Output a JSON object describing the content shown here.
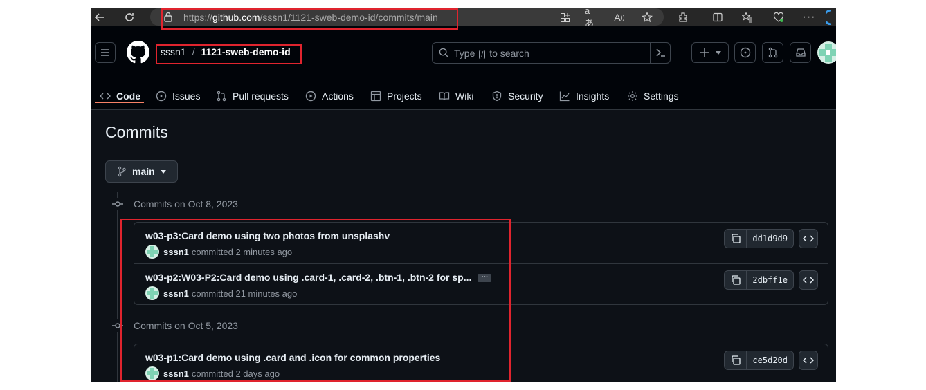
{
  "browser": {
    "url_prefix": "https://",
    "url_host": "github.com",
    "url_path": "/sssn1/1121-sweb-demo-id/commits/main"
  },
  "header": {
    "owner": "sssn1",
    "separator": "/",
    "repo": "1121-sweb-demo-id",
    "search_before": "Type",
    "search_key": "/",
    "search_after": "to search"
  },
  "nav": {
    "tabs": [
      {
        "label": "Code",
        "icon": "code-icon"
      },
      {
        "label": "Issues",
        "icon": "issue-icon"
      },
      {
        "label": "Pull requests",
        "icon": "pull-request-icon"
      },
      {
        "label": "Actions",
        "icon": "play-icon"
      },
      {
        "label": "Projects",
        "icon": "table-icon"
      },
      {
        "label": "Wiki",
        "icon": "book-icon"
      },
      {
        "label": "Security",
        "icon": "shield-icon"
      },
      {
        "label": "Insights",
        "icon": "graph-icon"
      },
      {
        "label": "Settings",
        "icon": "gear-icon"
      }
    ]
  },
  "main": {
    "title": "Commits",
    "branch": "main",
    "groups": [
      {
        "heading": "Commits on Oct 8, 2023",
        "commits": [
          {
            "message": "w03-p3:Card demo using two photos from unsplashv",
            "author": "sssn1",
            "committed": "committed",
            "time": "2 minutes ago",
            "sha": "dd1d9d9",
            "truncated": false
          },
          {
            "message": "w03-p2:W03-P2:Card demo using .card-1, .card-2, .btn-1, .btn-2 for sp...",
            "author": "sssn1",
            "committed": "committed",
            "time": "21 minutes ago",
            "sha": "2dbff1e",
            "truncated": true
          }
        ]
      },
      {
        "heading": "Commits on Oct 5, 2023",
        "commits": [
          {
            "message": "w03-p1:Card demo using .card and .icon for common properties",
            "author": "sssn1",
            "committed": "committed",
            "time": "2 days ago",
            "sha": "ce5d20d",
            "truncated": false
          }
        ]
      }
    ]
  },
  "colors": {
    "accent_underline": "#f78166",
    "highlight_box": "#e0242e",
    "canvas": "#0d1117"
  }
}
